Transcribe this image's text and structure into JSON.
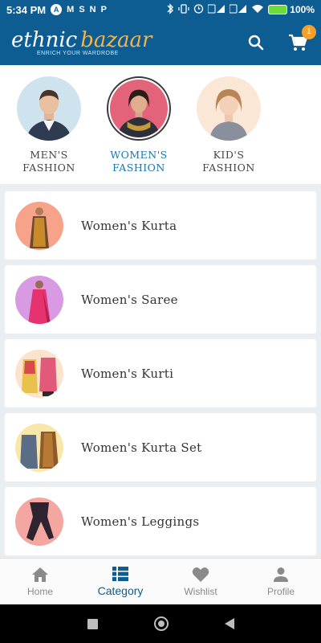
{
  "status_bar": {
    "time": "5:34 PM",
    "left_glyphs": [
      "A",
      "M",
      "S",
      "N",
      "P"
    ],
    "battery": "100%"
  },
  "app_bar": {
    "logo_word1": "ethnic",
    "logo_word2": "bazaar",
    "tagline": "ENRICH YOUR WARDROBE",
    "cart_count": "1",
    "accent_color": "#0d5d93",
    "badge_color": "#f4a02a"
  },
  "gender_categories": [
    {
      "label": "MEN'S\nFASHION",
      "icon": "men-avatar",
      "active": false
    },
    {
      "label": "WOMEN'S\nFASHION",
      "icon": "women-avatar",
      "active": true
    },
    {
      "label": "KID'S\nFASHION",
      "icon": "kids-avatar",
      "active": false
    }
  ],
  "categories": [
    {
      "label": "Women's Kurta",
      "thumb_bg": "#f7a38a"
    },
    {
      "label": "Women's Saree",
      "thumb_bg": "#d89ae3"
    },
    {
      "label": "Women's Kurti",
      "thumb_bg": "#fbe3cd"
    },
    {
      "label": "Women's Kurta Set",
      "thumb_bg": "#f8e7a8"
    },
    {
      "label": "Women's Leggings",
      "thumb_bg": "#f4a6a0"
    }
  ],
  "bottom_nav": [
    {
      "label": "Home",
      "icon": "home-icon",
      "active": false
    },
    {
      "label": "Category",
      "icon": "category-icon",
      "active": true
    },
    {
      "label": "Wishlist",
      "icon": "heart-icon",
      "active": false
    },
    {
      "label": "Profile",
      "icon": "person-icon",
      "active": false
    }
  ]
}
